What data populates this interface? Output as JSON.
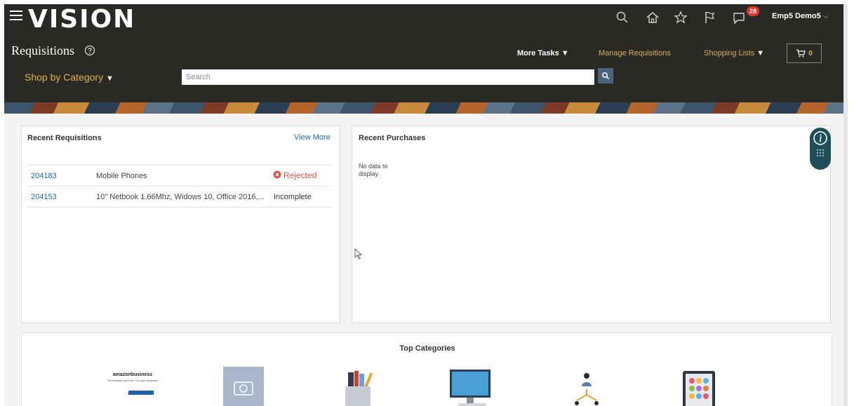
{
  "header": {
    "logo": "VISION",
    "notification_count": "28",
    "user_name": "Emp5 Demo5",
    "page_title": "Requisitions",
    "more_tasks": "More Tasks",
    "manage_requisitions": "Manage Requisitions",
    "shopping_lists": "Shopping Lists",
    "cart_count": "0",
    "shop_by_category": "Shop by Category",
    "search_placeholder": "Search"
  },
  "recent_requisitions": {
    "title": "Recent Requisitions",
    "view_more": "View More",
    "rows": [
      {
        "id": "204183",
        "description": "Mobile Phones",
        "status": "Rejected"
      },
      {
        "id": "204153",
        "description": "10\" Netbook 1.66Mhz, Widows 10, Office 2016,...",
        "status": "Incomplete"
      }
    ]
  },
  "recent_purchases": {
    "title": "Recent Purchases",
    "empty_line1": "No data to",
    "empty_line2": "display."
  },
  "top_categories": {
    "title": "Top Categories",
    "amazon_text": "amazonbusiness",
    "amazon_tagline": "The Amazon you love. For your business."
  },
  "colors": {
    "header_bg": "#2b2926",
    "accent_gold": "#d4b15a",
    "link_blue": "#1f6e9c",
    "rejected_red": "#d9534f",
    "badge_red": "#e0342c"
  }
}
